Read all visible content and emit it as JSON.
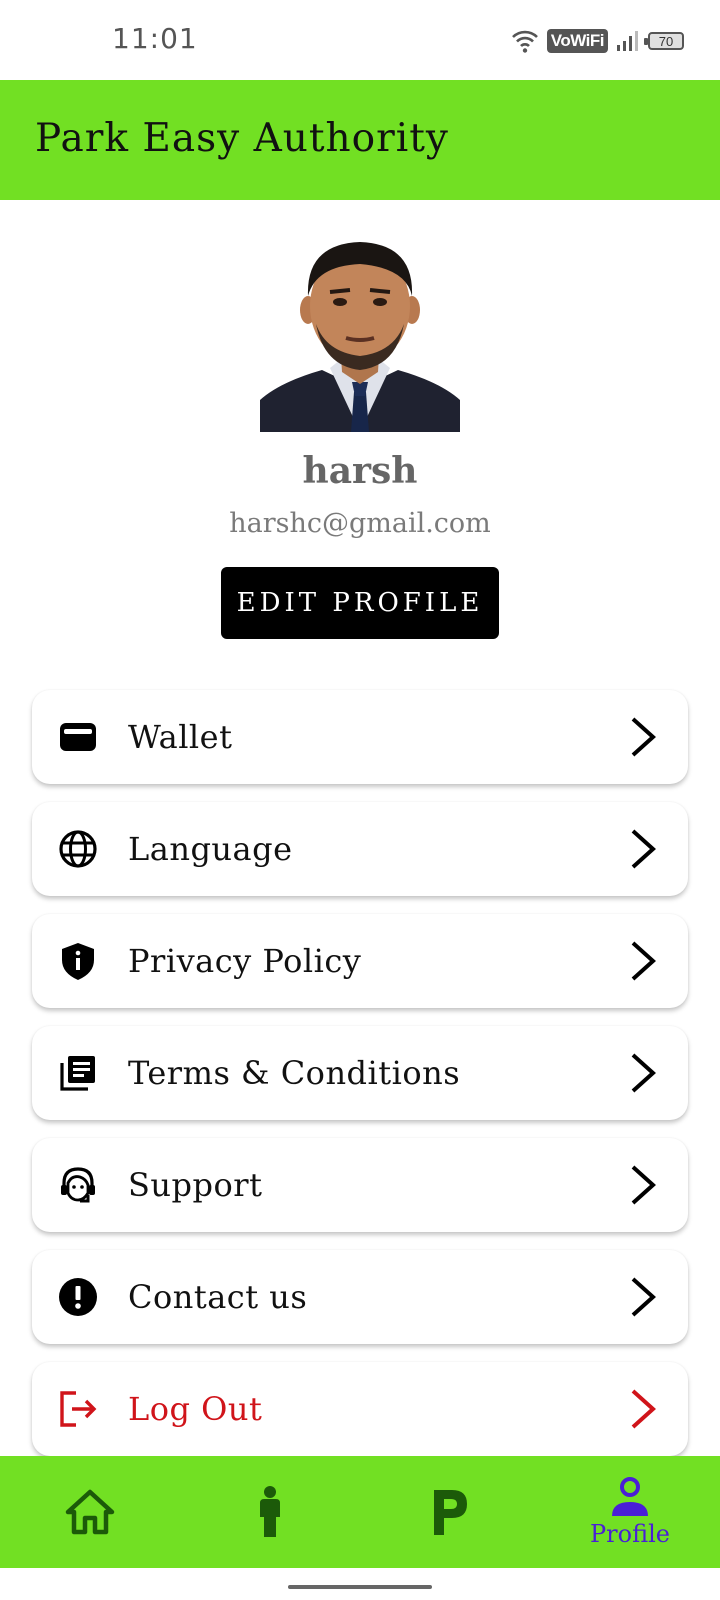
{
  "status_bar": {
    "time": "11:01",
    "network_label": "VoWiFi",
    "battery": "70"
  },
  "app_bar": {
    "title": "Park Easy Authority",
    "color": "#72e023"
  },
  "profile": {
    "name": "harsh",
    "email": "harshc@gmail.com",
    "edit_button": "EDIT PROFILE"
  },
  "menu": [
    {
      "label": "Wallet",
      "icon": "wallet-icon"
    },
    {
      "label": "Language",
      "icon": "globe-icon"
    },
    {
      "label": "Privacy Policy",
      "icon": "shield-icon"
    },
    {
      "label": "Terms & Conditions",
      "icon": "library-books-icon"
    },
    {
      "label": "Support",
      "icon": "support-agent-icon"
    },
    {
      "label": "Contact us",
      "icon": "exclamation-circle-icon"
    },
    {
      "label": "Log Out",
      "icon": "logout-icon",
      "color": "#d0141a"
    }
  ],
  "bottom_nav": {
    "items": [
      {
        "icon": "home-icon"
      },
      {
        "icon": "person-standing-icon"
      },
      {
        "icon": "parking-icon"
      },
      {
        "icon": "profile-icon",
        "label": "Profile",
        "active": true
      }
    ],
    "active_color": "#4a1fd6"
  }
}
